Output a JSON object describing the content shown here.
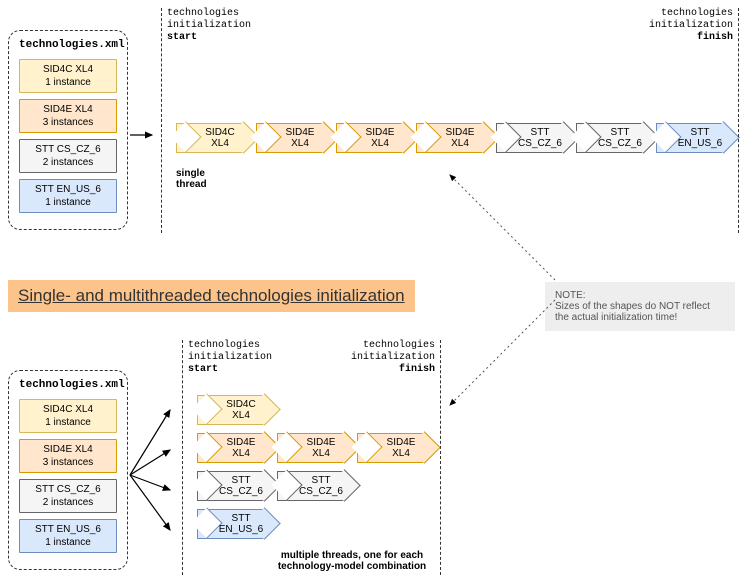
{
  "xml_filename": "technologies.xml",
  "tech_items": [
    {
      "name": "SID4C  XL4",
      "instances": "1 instance",
      "color": "yellow"
    },
    {
      "name": "SID4E  XL4",
      "instances": "3 instances",
      "color": "orange"
    },
    {
      "name": "STT CS_CZ_6",
      "instances": "2 instances",
      "color": "grey"
    },
    {
      "name": "STT EN_US_6",
      "instances": "1 instance",
      "color": "blue"
    }
  ],
  "phase_start": {
    "l1": "technologies",
    "l2": "initialization",
    "l3": "start"
  },
  "phase_finish": {
    "l1": "technologies",
    "l2": "initialization",
    "l3": "finish"
  },
  "single": {
    "caption": "single thread",
    "sequence": [
      {
        "l1": "SID4C",
        "l2": "XL4",
        "color": "yellow"
      },
      {
        "l1": "SID4E",
        "l2": "XL4",
        "color": "orange"
      },
      {
        "l1": "SID4E",
        "l2": "XL4",
        "color": "orange"
      },
      {
        "l1": "SID4E",
        "l2": "XL4",
        "color": "orange"
      },
      {
        "l1": "STT",
        "l2": "CS_CZ_6",
        "color": "grey"
      },
      {
        "l1": "STT",
        "l2": "CS_CZ_6",
        "color": "grey"
      },
      {
        "l1": "STT",
        "l2": "EN_US_6",
        "color": "blue"
      }
    ]
  },
  "multi": {
    "caption": "multiple threads, one for each technology-model combination",
    "rows": [
      [
        {
          "l1": "SID4C",
          "l2": "XL4",
          "color": "yellow"
        }
      ],
      [
        {
          "l1": "SID4E",
          "l2": "XL4",
          "color": "orange"
        },
        {
          "l1": "SID4E",
          "l2": "XL4",
          "color": "orange"
        },
        {
          "l1": "SID4E",
          "l2": "XL4",
          "color": "orange"
        }
      ],
      [
        {
          "l1": "STT",
          "l2": "CS_CZ_6",
          "color": "grey"
        },
        {
          "l1": "STT",
          "l2": "CS_CZ_6",
          "color": "grey"
        }
      ],
      [
        {
          "l1": "STT",
          "l2": "EN_US_6",
          "color": "blue"
        }
      ]
    ]
  },
  "banner": "Single- and multithreaded technologies initialization",
  "note": {
    "title": "NOTE:",
    "body": "Sizes of the shapes do NOT reflect the actual initialization time!"
  }
}
